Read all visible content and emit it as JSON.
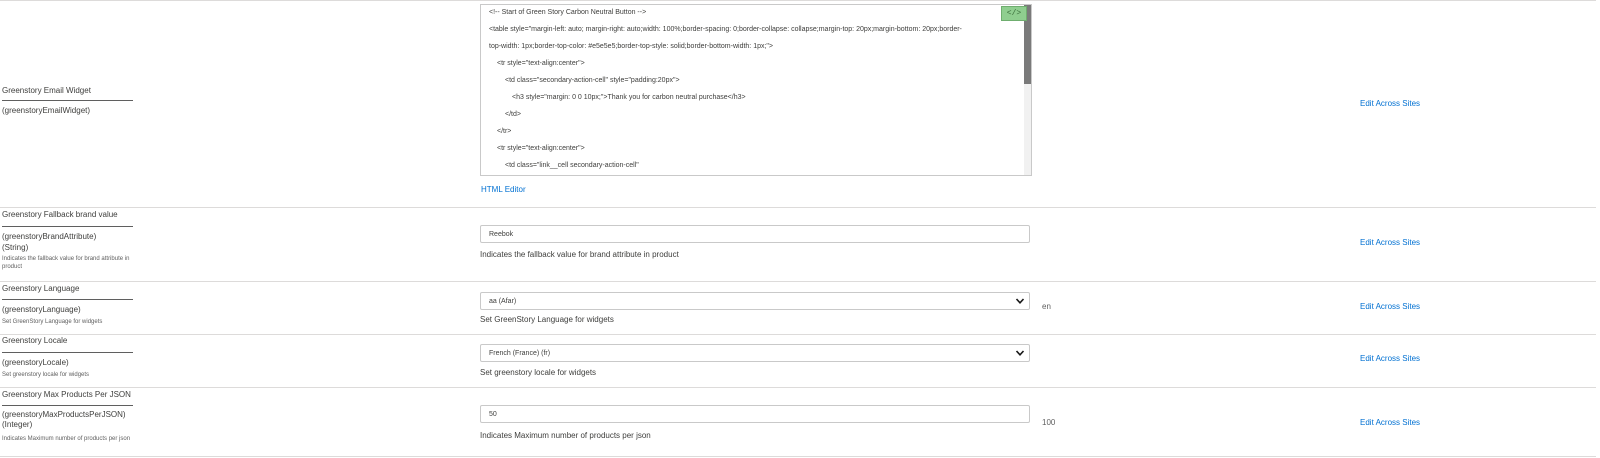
{
  "rows": [
    {
      "title": "Greenstory Email Widget",
      "key": "(greenstoryEmailWidget)",
      "editor": {
        "code_lines": [
          "<!-- Start of Green Story Carbon Neutral Button -->",
          "<table style=\"margin-left: auto; margin-right: auto;width: 100%;border-spacing: 0;border-collapse: collapse;margin-top: 20px;margin-bottom: 20px;border-",
          "top-width: 1px;border-top-color: #e5e5e5;border-top-style: solid;border-bottom-width: 1px;\">",
          "<tr style=\"text-align:center\">",
          "<td class=\"secondary-action-cell\" style=\"padding:20px\">",
          "<h3 style=\"margin: 0 0 10px;\">Thank you for carbon neutral purchase</h3>",
          "</td>",
          "</tr>",
          "<tr style=\"text-align:center\">",
          "<td class=\"link__cell secondary-action-cell\""
        ],
        "code_button_label": "</>",
        "html_editor_link": "HTML Editor"
      },
      "edit_link": "Edit Across Sites"
    },
    {
      "title": "Greenstory Fallback brand value",
      "key": "(greenstoryBrandAttribute)",
      "type": "(String)",
      "description": "Indicates the fallback value for brand attribute in product",
      "value": "Reebok",
      "help": "Indicates the fallback value for brand attribute in product",
      "edit_link": "Edit Across Sites"
    },
    {
      "title": "Greenstory Language",
      "key": "(greenstoryLanguage)",
      "description": "Set GreenStory Language for widgets",
      "selected": "aa (Afar)",
      "help": "Set GreenStory Language for widgets",
      "default": "en",
      "edit_link": "Edit Across Sites"
    },
    {
      "title": "Greenstory Locale",
      "key": "(greenstoryLocale)",
      "description": "Set greenstory locale for widgets",
      "selected": "French (France) (fr)",
      "help": "Set greenstory locale for widgets",
      "edit_link": "Edit Across Sites"
    },
    {
      "title": "Greenstory Max Products Per JSON",
      "key": "(greenstoryMaxProductsPerJSON)",
      "type": "(Integer)",
      "description": "Indicates Maximum number of products per json",
      "value": "50",
      "help": "Indicates Maximum number of products per json",
      "default": "100",
      "edit_link": "Edit Across Sites"
    }
  ]
}
